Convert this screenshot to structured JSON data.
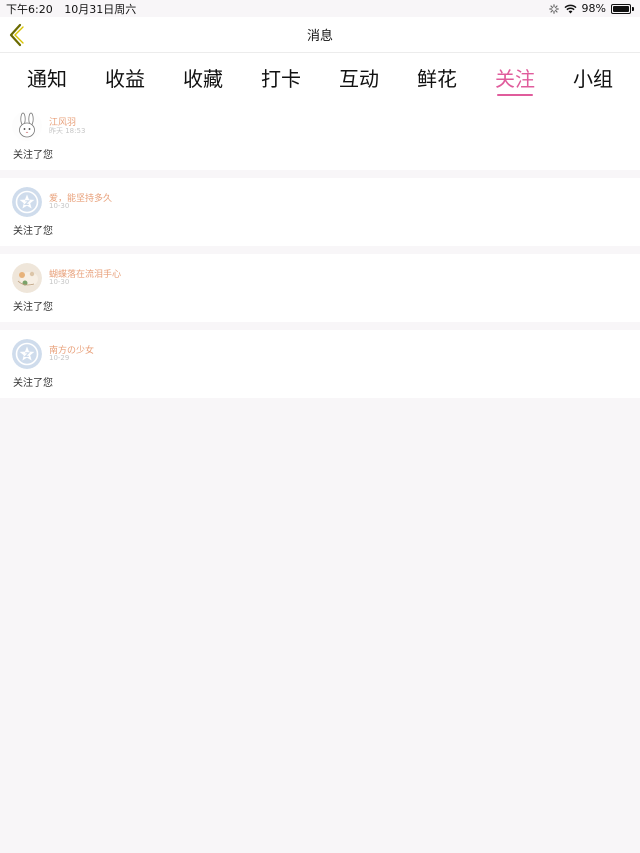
{
  "status": {
    "time": "下午6:20",
    "date": "10月31日周六",
    "battery": "98%",
    "battery_level": 0.98
  },
  "nav": {
    "title": "消息",
    "back_icon": "chevron-left-icon"
  },
  "tabs": [
    {
      "label": "通知"
    },
    {
      "label": "收益"
    },
    {
      "label": "收藏"
    },
    {
      "label": "打卡"
    },
    {
      "label": "互动"
    },
    {
      "label": "鲜花"
    },
    {
      "label": "关注",
      "active": true
    },
    {
      "label": "小组"
    }
  ],
  "colors": {
    "accent": "#e05c9c",
    "username": "#e8a07a",
    "timestamp": "#c6c6c6"
  },
  "items": [
    {
      "name": "江风羽",
      "time": "昨天 18:53",
      "message": "关注了您",
      "avatar": "rabbit-avatar"
    },
    {
      "name": "爱，能坚持多久",
      "time": "10-30",
      "message": "关注了您",
      "avatar": "default-star-avatar"
    },
    {
      "name": "蝴蝶落在流泪手心",
      "time": "10-30",
      "message": "关注了您",
      "avatar": "photo-avatar"
    },
    {
      "name": "南方の少女",
      "time": "10-29",
      "message": "关注了您",
      "avatar": "default-star-avatar"
    }
  ]
}
